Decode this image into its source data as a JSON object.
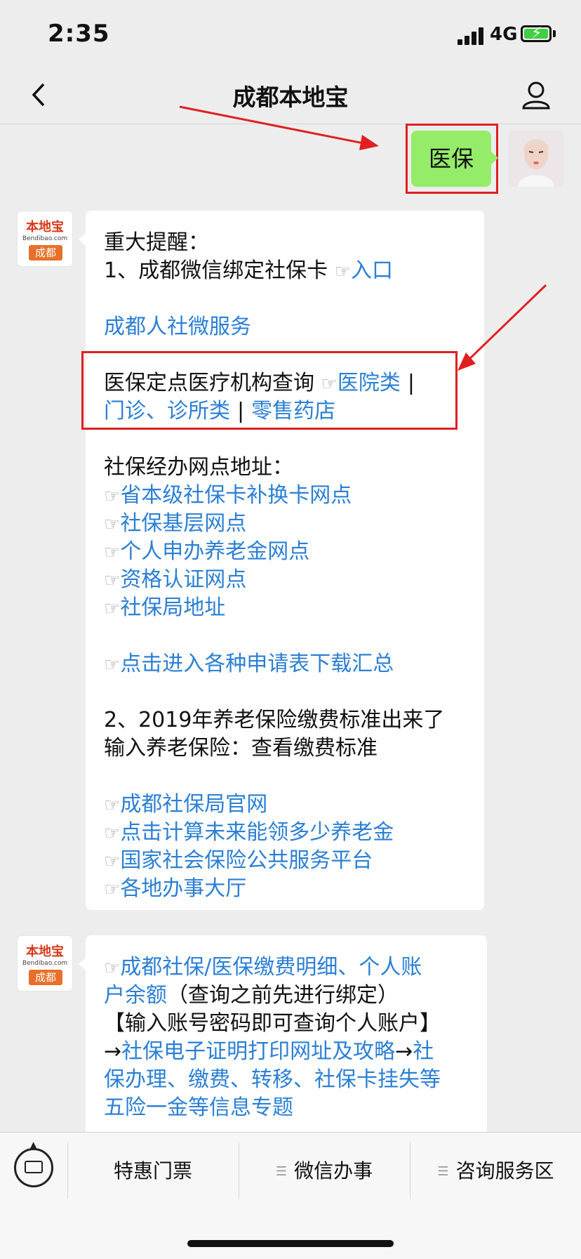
{
  "status_bar": {
    "time": "2:35",
    "network": "4G"
  },
  "nav": {
    "title": "成都本地宝"
  },
  "my_message": {
    "text": "医保"
  },
  "bot_avatar": {
    "brand": "本地宝",
    "domain": "Bendibao.com",
    "city": "成都"
  },
  "message1": {
    "heading": "重大提醒：",
    "item1_text": "1、成都微信绑定社保卡",
    "entry_link": "入口",
    "rs_link": "成都人社微服务",
    "medical_text": "医保定点医疗机构查询",
    "hospital_link": "医院类",
    "sep1": "|",
    "clinic_link": "门诊、诊所类",
    "sep2": "|",
    "pharmacy_link": "零售药店",
    "offices_heading": "社保经办网点地址：",
    "office_links": [
      "省本级社保卡补换卡网点",
      "社保基层网点",
      "个人申办养老金网点",
      "资格认证网点",
      "社保局地址"
    ],
    "forms_link": "点击进入各种申请表下载汇总",
    "item2_line1": "2、2019年养老保险缴费标准出来了",
    "item2_line2": "输入养老保险：查看缴费标准",
    "bottom_links": [
      "成都社保局官网",
      "点击计算未来能领多少养老金",
      "国家社会保险公共服务平台",
      "各地办事大厅"
    ]
  },
  "message2": {
    "link1_part1": "成都社保/医保缴费明细、个人账",
    "link1_part2": "户余额",
    "note": "（查询之前先进行绑定）",
    "line3": "【输入账号密码即可查询个人账户】",
    "arrow": "→",
    "link2": "社保电子证明打印网址及攻略",
    "link3_part1": "社",
    "link3_part2": "保办理、缴费、转移、社保卡挂失等",
    "link3_part3": "五险一金等信息专题"
  },
  "bottom_menu": {
    "item1": "特惠门票",
    "item2": "微信办事",
    "item3": "咨询服务区"
  },
  "icons": {
    "hand": "☞",
    "menu": "☰"
  },
  "colors": {
    "link": "#2b7fd4",
    "my_bubble": "#95ec69",
    "highlight": "#e02020",
    "background": "#ededed"
  }
}
